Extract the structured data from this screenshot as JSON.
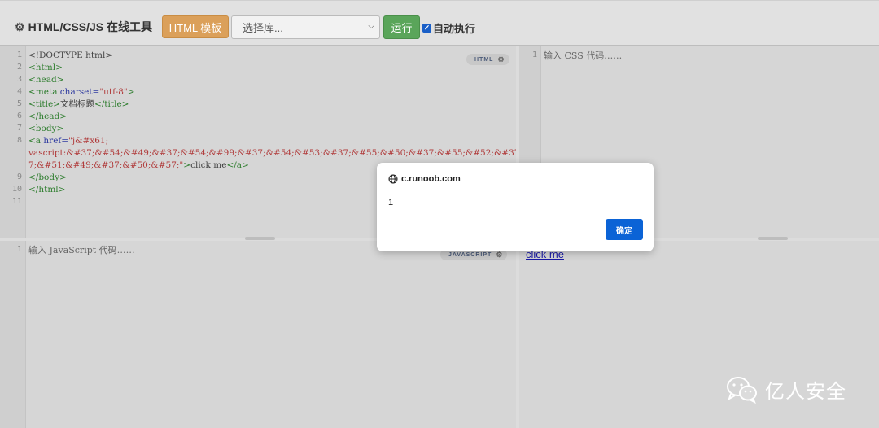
{
  "header": {
    "title": "HTML/CSS/JS 在线工具",
    "template_button": "HTML 模板",
    "library_select": "选择库...",
    "run_button": "运行",
    "auto_run_label": "自动执行"
  },
  "html_editor": {
    "badge": "HTML",
    "line_numbers": [
      "1",
      "2",
      "3",
      "4",
      "5",
      "6",
      "7",
      "8",
      "",
      "",
      "9",
      "10",
      "11"
    ],
    "lines": {
      "l1": "<!DOCTYPE html>",
      "l2": "<html>",
      "l3": "<head>",
      "l4_tag": "<meta ",
      "l4_attr": "charset=",
      "l4_str": "\"utf-8\"",
      "l4_end": ">",
      "l5_open": "<title>",
      "l5_text": "文档标题",
      "l5_close": "</title>",
      "l6": "</head>",
      "l7": "<body>",
      "l8_tag": "<a ",
      "l8_attr": "href=",
      "l8_str": "\"j&#x61;",
      "l8b": "vascript:&#37;&#54;&#49;&#37;&#54;&#99;&#37;&#54;&#53;&#37;&#55;&#50;&#37;&#55;&#52;&#37;&#50;&#56;&#3",
      "l8c_str": "7;&#51;&#49;&#37;&#50;&#57;\"",
      "l8c_gt": ">",
      "l8c_text": "click me",
      "l8c_close": "</a>",
      "l9": "</body>",
      "l10": "</html>"
    }
  },
  "css_editor": {
    "line_numbers": [
      "1"
    ],
    "placeholder": "输入 CSS 代码……"
  },
  "js_editor": {
    "badge": "JAVASCRIPT",
    "line_numbers": [
      "1"
    ],
    "placeholder": "输入 JavaScript 代码……"
  },
  "result": {
    "link_text": "click me"
  },
  "alert_dialog": {
    "origin": "c.runoob.com",
    "message": "1",
    "ok_button": "确定"
  },
  "watermark": {
    "text": "亿人安全"
  },
  "icons": {
    "title_icon": "gears-icon",
    "badge_icon": "cog-icon",
    "origin_icon": "globe-icon",
    "watermark_icon": "wechat-icon"
  }
}
